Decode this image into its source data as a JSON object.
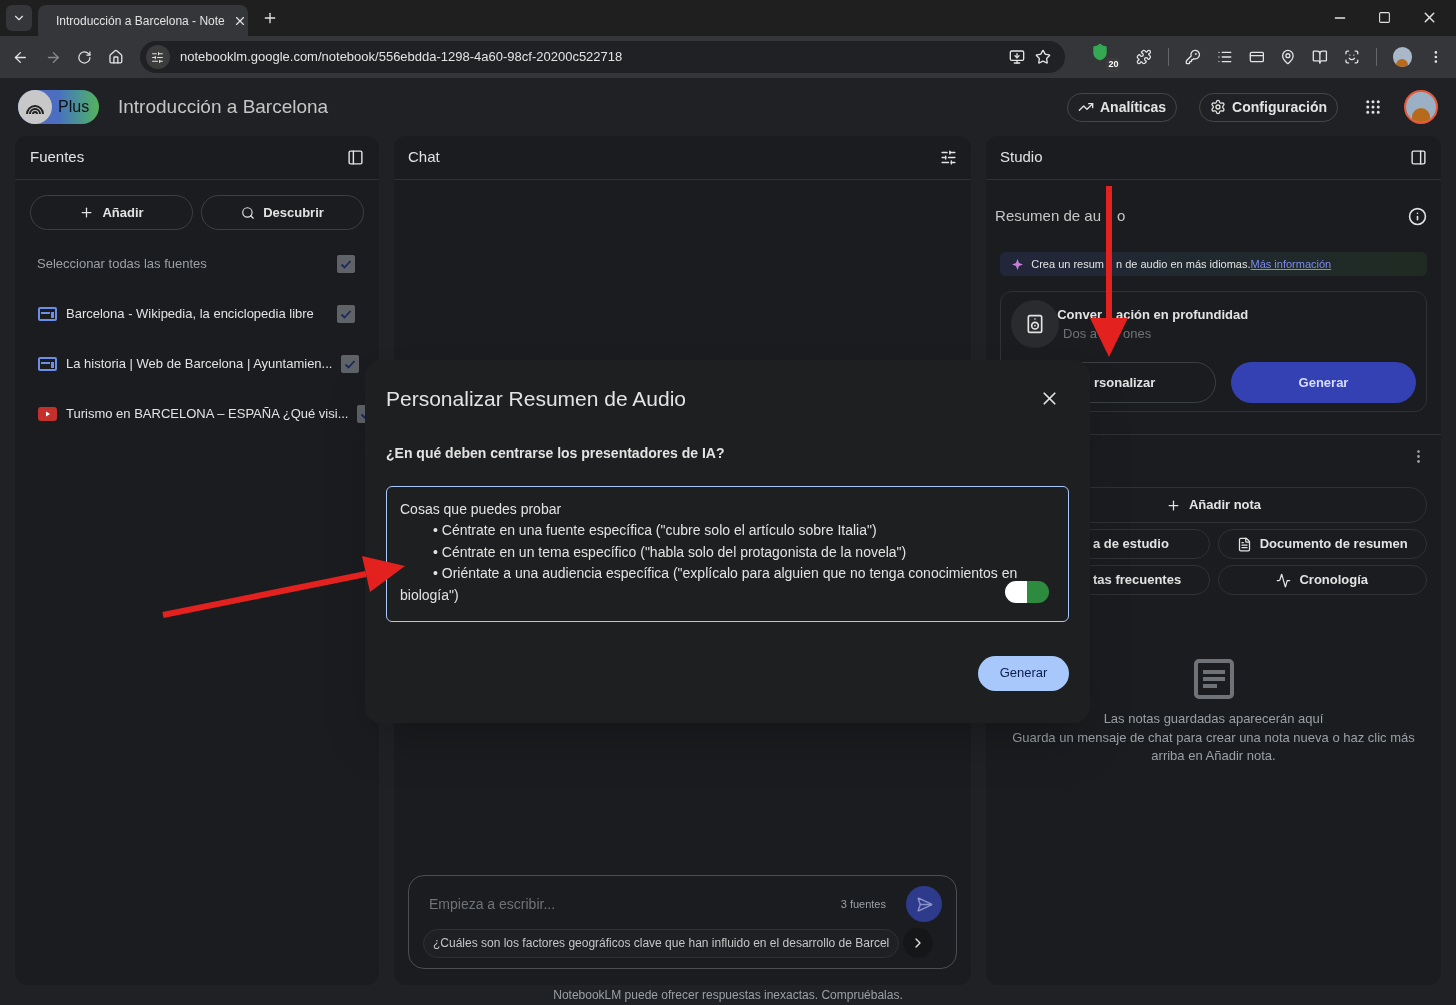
{
  "browser": {
    "tab_title": "Introducción a Barcelona - Note",
    "url": "notebooklm.google.com/notebook/556ebdda-1298-4a60-98cf-20200c522718",
    "extension_badge": "20"
  },
  "header": {
    "plan_badge": "Plus",
    "title": "Introducción a Barcelona",
    "buttons": [
      {
        "kind": "analytics",
        "label": "Analíticas"
      },
      {
        "kind": "settings",
        "label": "Configuración"
      }
    ]
  },
  "sources": {
    "title": "Fuentes",
    "actions": [
      {
        "kind": "add",
        "label": "Añadir"
      },
      {
        "kind": "discover",
        "label": "Descubrir"
      }
    ],
    "select_all": {
      "label": "Seleccionar todas las fuentes",
      "checked": true
    },
    "items": [
      {
        "kind": "web",
        "title": "Barcelona - Wikipedia, la enciclopedia libre",
        "checked": true
      },
      {
        "kind": "web",
        "title": "La historia | Web de Barcelona | Ayuntamien...",
        "checked": true
      },
      {
        "kind": "video",
        "title": "Turismo en BARCELONA – ESPAÑA ¿Qué visi...",
        "checked": true
      }
    ]
  },
  "chat": {
    "title": "Chat",
    "input": {
      "placeholder": "Empieza a escribir..."
    },
    "source_count": "3 fuentes",
    "suggestion": "¿Cuáles son los factores geográficos clave que han influido en el desarrollo de Barcel"
  },
  "studio": {
    "title": "Studio",
    "audio": {
      "title": [
        "Resumen de au",
        "o"
      ],
      "banner": [
        "Crea un resum",
        "n de audio en más idiomas."
      ],
      "banner_link": "Más información",
      "format": {
        "title": [
          "Conver",
          "ación en profundidad"
        ],
        "subtitle": [
          "Dos a",
          "ones"
        ]
      },
      "customize_button": "rsonalizar",
      "generate_button": "Generar"
    },
    "notes": {
      "add_button": "Añadir nota",
      "actions": [
        {
          "kind": "clipped",
          "label": "a de estudio"
        },
        {
          "kind": "document",
          "label": "Documento de resumen"
        },
        {
          "kind": "clipped",
          "label": "tas frecuentes"
        },
        {
          "kind": "timeline",
          "label": "Cronología"
        }
      ],
      "empty_title": "Las notas guardadas aparecerán aquí",
      "empty_text": "Guarda un mensaje de chat para crear una nota nueva o haz clic más arriba en Añadir nota."
    }
  },
  "dialog": {
    "title": "Personalizar Resumen de Audio",
    "question": "¿En qué deben centrarse los presentadores de IA?",
    "placeholder": {
      "intro": "Cosas que puedes probar",
      "bullets": [
        "• Céntrate en una fuente específica (\"cubre solo el artículo sobre Italia\")",
        "• Céntrate en un tema específico (\"habla solo del protagonista de la novela\")",
        "• Oriéntate a una audiencia específica (\"explícalo para alguien que no tenga conocimientos en biología\")"
      ]
    },
    "generate_button": "Generar"
  },
  "footer": "NotebookLM puede ofrecer respuestas inexactas. Compruébalas."
}
